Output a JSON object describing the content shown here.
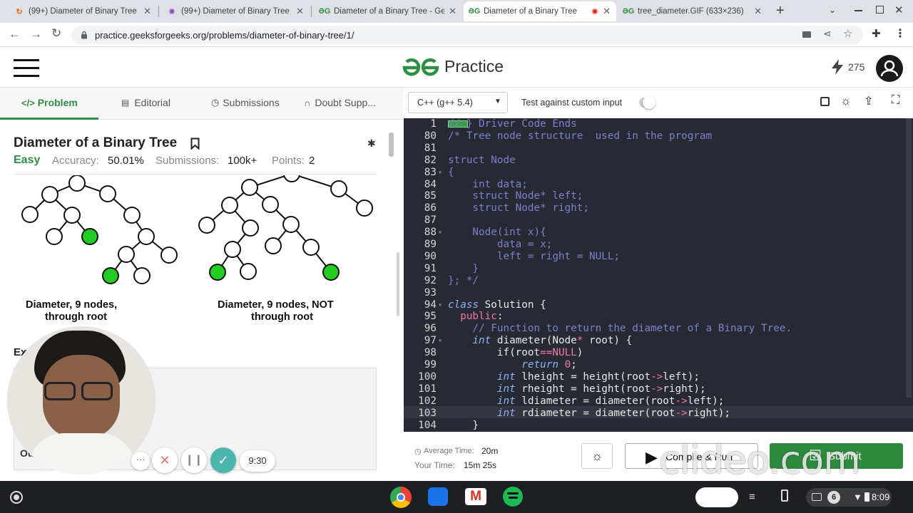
{
  "browser": {
    "tabs": [
      {
        "label": "(99+) Diameter of Binary Tree",
        "active": false
      },
      {
        "label": "(99+) Diameter of Binary Tree",
        "active": false
      },
      {
        "label": "Diameter of a Binary Tree - Gee",
        "active": false
      },
      {
        "label": "Diameter of a Binary Tree",
        "active": true
      },
      {
        "label": "tree_diameter.GIF (633×236)",
        "active": false
      }
    ],
    "url": "practice.geeksforgeeks.org/problems/diameter-of-binary-tree/1/"
  },
  "header": {
    "logo_text": "Practice",
    "streak_count": "275"
  },
  "left_tabs": {
    "problem": "Problem",
    "editorial": "Editorial",
    "submissions": "Submissions",
    "doubt": "Doubt Supp..."
  },
  "problem": {
    "title": "Diameter of a Binary Tree",
    "difficulty": "Easy",
    "accuracy_label": "Accuracy:",
    "accuracy_value": "50.01%",
    "submissions_label": "Submissions:",
    "submissions_value": "100k+",
    "points_label": "Points:",
    "points_value": "2",
    "caption_left_1": "Diameter, 9 nodes,",
    "caption_left_2": "through root",
    "caption_right_1": "Diameter, 9 nodes, NOT",
    "caption_right_2": "through root",
    "example_label_partial": "Ex",
    "output_partial": "Ou"
  },
  "recorder": {
    "timer": "9:30"
  },
  "toolbar": {
    "language": "C++ (g++ 5.4)",
    "custom_input_label": "Test against custom input"
  },
  "code_lines": [
    {
      "n": "1",
      "text": "// } Driver Code Ends"
    },
    {
      "n": "80",
      "text": "/* Tree node structure  used in the program"
    },
    {
      "n": "81",
      "text": ""
    },
    {
      "n": "82",
      "text": "struct Node"
    },
    {
      "n": "83",
      "text": "{"
    },
    {
      "n": "84",
      "text": "    int data;"
    },
    {
      "n": "85",
      "text": "    struct Node* left;"
    },
    {
      "n": "86",
      "text": "    struct Node* right;"
    },
    {
      "n": "87",
      "text": ""
    },
    {
      "n": "88",
      "text": "    Node(int x){"
    },
    {
      "n": "89",
      "text": "        data = x;"
    },
    {
      "n": "90",
      "text": "        left = right = NULL;"
    },
    {
      "n": "91",
      "text": "    }"
    },
    {
      "n": "92",
      "text": "}; */"
    },
    {
      "n": "93",
      "text": ""
    },
    {
      "n": "94",
      "text": "class Solution {"
    },
    {
      "n": "95",
      "text": "  public:"
    },
    {
      "n": "96",
      "text": "    // Function to return the diameter of a Binary Tree."
    },
    {
      "n": "97",
      "text": "    int diameter(Node* root) {"
    },
    {
      "n": "98",
      "text": "        if(root==NULL)"
    },
    {
      "n": "99",
      "text": "            return 0;"
    },
    {
      "n": "100",
      "text": "        int lheight = height(root->left);"
    },
    {
      "n": "101",
      "text": "        int rheight = height(root->right);"
    },
    {
      "n": "102",
      "text": "        int ldiameter = diameter(root->left);"
    },
    {
      "n": "103",
      "text": "        int rdiameter = diameter(root->right);"
    },
    {
      "n": "104",
      "text": "    }"
    }
  ],
  "bottom": {
    "avg_time_label": "Average Time:",
    "avg_time_value": "20m",
    "your_time_label": "Your Time:",
    "your_time_value": "15m 25s",
    "compile_label": "Compile & Run",
    "submit_label": "Submit",
    "watermark": "clideo.com"
  },
  "taskbar": {
    "notification_count": "6",
    "clock": "8:09"
  },
  "colors": {
    "gfg_green": "#2f8d46",
    "editor_bg": "#272a33",
    "submit_green": "#2e8b3e",
    "tree_highlight": "#22cc22"
  }
}
